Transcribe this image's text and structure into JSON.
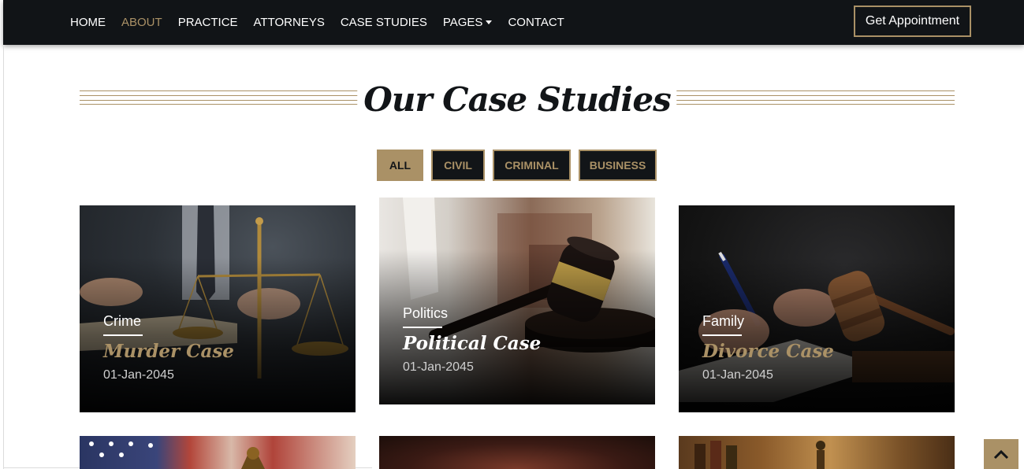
{
  "nav": {
    "items": [
      {
        "label": "HOME",
        "active": false
      },
      {
        "label": "ABOUT",
        "active": true
      },
      {
        "label": "PRACTICE",
        "active": false
      },
      {
        "label": "ATTORNEYS",
        "active": false
      },
      {
        "label": "CASE STUDIES",
        "active": false
      },
      {
        "label": "PAGES",
        "active": false,
        "dropdown": true
      },
      {
        "label": "CONTACT",
        "active": false
      }
    ],
    "cta_label": "Get Appointment"
  },
  "section": {
    "title": "Our Case Studies"
  },
  "filters": [
    {
      "label": "ALL",
      "active": true
    },
    {
      "label": "CIVIL",
      "active": false
    },
    {
      "label": "CRIMINAL",
      "active": false
    },
    {
      "label": "BUSINESS",
      "active": false
    }
  ],
  "cards": [
    {
      "category": "Crime",
      "title": "Murder Case",
      "date": "01-Jan-2045",
      "title_color": "#aa9166",
      "image": "scales-of-justice-desk"
    },
    {
      "category": "Politics",
      "title": "Political Case",
      "date": "01-Jan-2045",
      "title_color": "#ffffff",
      "image": "gavel-on-block"
    },
    {
      "category": "Family",
      "title": "Divorce Case",
      "date": "01-Jan-2045",
      "title_color": "#aa9166",
      "image": "signing-document-gavel"
    },
    {
      "image": "flag-and-lady-justice"
    },
    {
      "image": "dark-wood"
    },
    {
      "image": "library-justice-statue"
    }
  ],
  "colors": {
    "accent": "#aa9166",
    "dark": "#121518",
    "nav_bg": "#111417"
  },
  "back_to_top_icon": "chevron-up-icon"
}
